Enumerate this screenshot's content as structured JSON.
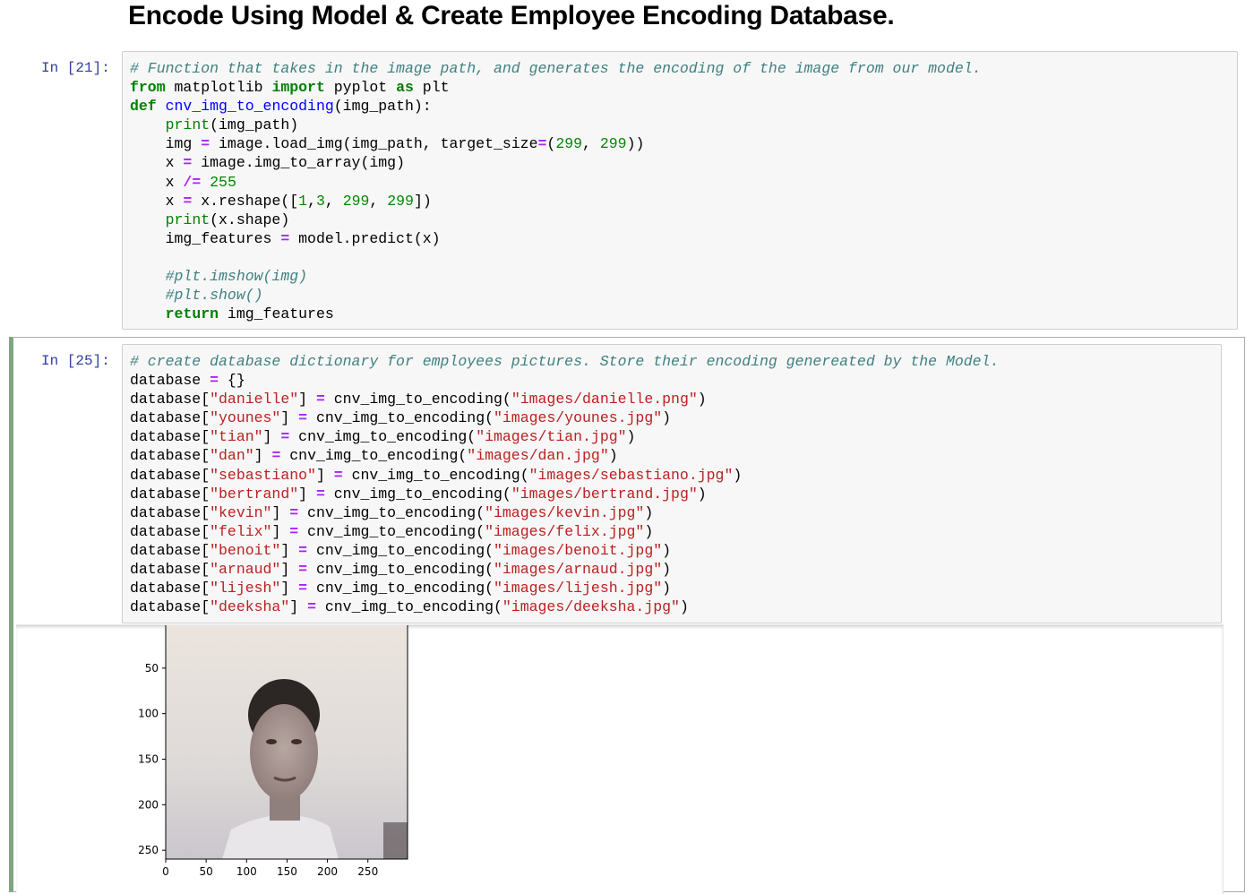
{
  "heading": "Encode Using Model & Create Employee Encoding Database.",
  "cell1": {
    "prompt": "In [21]:",
    "lines": [
      [
        {
          "t": "# Function that takes in the image path, and generates the encoding of the image from our model.",
          "c": "cm-comment"
        }
      ],
      [
        {
          "t": "from",
          "c": "cm-keyword"
        },
        {
          "t": " matplotlib "
        },
        {
          "t": "import",
          "c": "cm-keyword"
        },
        {
          "t": " pyplot "
        },
        {
          "t": "as",
          "c": "cm-keyword"
        },
        {
          "t": " plt"
        }
      ],
      [
        {
          "t": "def",
          "c": "cm-keyword"
        },
        {
          "t": " "
        },
        {
          "t": "cnv_img_to_encoding",
          "c": "cm-def"
        },
        {
          "t": "(img_path):"
        }
      ],
      [
        {
          "t": "    "
        },
        {
          "t": "print",
          "c": "cm-builtin"
        },
        {
          "t": "(img_path)"
        }
      ],
      [
        {
          "t": "    img "
        },
        {
          "t": "=",
          "c": "cm-operator"
        },
        {
          "t": " image.load_img(img_path, target_size"
        },
        {
          "t": "=",
          "c": "cm-operator"
        },
        {
          "t": "("
        },
        {
          "t": "299",
          "c": "cm-number"
        },
        {
          "t": ", "
        },
        {
          "t": "299",
          "c": "cm-number"
        },
        {
          "t": "))"
        }
      ],
      [
        {
          "t": "    x "
        },
        {
          "t": "=",
          "c": "cm-operator"
        },
        {
          "t": " image.img_to_array(img)"
        }
      ],
      [
        {
          "t": "    x "
        },
        {
          "t": "/=",
          "c": "cm-operator"
        },
        {
          "t": " "
        },
        {
          "t": "255",
          "c": "cm-number"
        }
      ],
      [
        {
          "t": "    x "
        },
        {
          "t": "=",
          "c": "cm-operator"
        },
        {
          "t": " x.reshape(["
        },
        {
          "t": "1",
          "c": "cm-number"
        },
        {
          "t": ","
        },
        {
          "t": "3",
          "c": "cm-number"
        },
        {
          "t": ", "
        },
        {
          "t": "299",
          "c": "cm-number"
        },
        {
          "t": ", "
        },
        {
          "t": "299",
          "c": "cm-number"
        },
        {
          "t": "])"
        }
      ],
      [
        {
          "t": "    "
        },
        {
          "t": "print",
          "c": "cm-builtin"
        },
        {
          "t": "(x.shape)"
        }
      ],
      [
        {
          "t": "    img_features "
        },
        {
          "t": "=",
          "c": "cm-operator"
        },
        {
          "t": " model.predict(x)"
        }
      ],
      [
        {
          "t": ""
        }
      ],
      [
        {
          "t": "    "
        },
        {
          "t": "#plt.imshow(img)",
          "c": "cm-comment"
        }
      ],
      [
        {
          "t": "    "
        },
        {
          "t": "#plt.show()",
          "c": "cm-comment"
        }
      ],
      [
        {
          "t": "    "
        },
        {
          "t": "return",
          "c": "cm-keyword"
        },
        {
          "t": " img_features"
        }
      ]
    ]
  },
  "cell2": {
    "prompt": "In [25]:",
    "lines": [
      [
        {
          "t": "# create database dictionary for employees pictures. Store their encoding genereated by the Model.",
          "c": "cm-comment"
        }
      ],
      [
        {
          "t": "database "
        },
        {
          "t": "=",
          "c": "cm-operator"
        },
        {
          "t": " {}"
        }
      ],
      [
        {
          "t": "database["
        },
        {
          "t": "\"danielle\"",
          "c": "cm-string"
        },
        {
          "t": "] "
        },
        {
          "t": "=",
          "c": "cm-operator"
        },
        {
          "t": " cnv_img_to_encoding("
        },
        {
          "t": "\"images/danielle.png\"",
          "c": "cm-string"
        },
        {
          "t": ")"
        }
      ],
      [
        {
          "t": "database["
        },
        {
          "t": "\"younes\"",
          "c": "cm-string"
        },
        {
          "t": "] "
        },
        {
          "t": "=",
          "c": "cm-operator"
        },
        {
          "t": " cnv_img_to_encoding("
        },
        {
          "t": "\"images/younes.jpg\"",
          "c": "cm-string"
        },
        {
          "t": ")"
        }
      ],
      [
        {
          "t": "database["
        },
        {
          "t": "\"tian\"",
          "c": "cm-string"
        },
        {
          "t": "] "
        },
        {
          "t": "=",
          "c": "cm-operator"
        },
        {
          "t": " cnv_img_to_encoding("
        },
        {
          "t": "\"images/tian.jpg\"",
          "c": "cm-string"
        },
        {
          "t": ")"
        }
      ],
      [
        {
          "t": "database["
        },
        {
          "t": "\"dan\"",
          "c": "cm-string"
        },
        {
          "t": "] "
        },
        {
          "t": "=",
          "c": "cm-operator"
        },
        {
          "t": " cnv_img_to_encoding("
        },
        {
          "t": "\"images/dan.jpg\"",
          "c": "cm-string"
        },
        {
          "t": ")"
        }
      ],
      [
        {
          "t": "database["
        },
        {
          "t": "\"sebastiano\"",
          "c": "cm-string"
        },
        {
          "t": "] "
        },
        {
          "t": "=",
          "c": "cm-operator"
        },
        {
          "t": " cnv_img_to_encoding("
        },
        {
          "t": "\"images/sebastiano.jpg\"",
          "c": "cm-string"
        },
        {
          "t": ")"
        }
      ],
      [
        {
          "t": "database["
        },
        {
          "t": "\"bertrand\"",
          "c": "cm-string"
        },
        {
          "t": "] "
        },
        {
          "t": "=",
          "c": "cm-operator"
        },
        {
          "t": " cnv_img_to_encoding("
        },
        {
          "t": "\"images/bertrand.jpg\"",
          "c": "cm-string"
        },
        {
          "t": ")"
        }
      ],
      [
        {
          "t": "database["
        },
        {
          "t": "\"kevin\"",
          "c": "cm-string"
        },
        {
          "t": "] "
        },
        {
          "t": "=",
          "c": "cm-operator"
        },
        {
          "t": " cnv_img_to_encoding("
        },
        {
          "t": "\"images/kevin.jpg\"",
          "c": "cm-string"
        },
        {
          "t": ")"
        }
      ],
      [
        {
          "t": "database["
        },
        {
          "t": "\"felix\"",
          "c": "cm-string"
        },
        {
          "t": "] "
        },
        {
          "t": "=",
          "c": "cm-operator"
        },
        {
          "t": " cnv_img_to_encoding("
        },
        {
          "t": "\"images/felix.jpg\"",
          "c": "cm-string"
        },
        {
          "t": ")"
        }
      ],
      [
        {
          "t": "database["
        },
        {
          "t": "\"benoit\"",
          "c": "cm-string"
        },
        {
          "t": "] "
        },
        {
          "t": "=",
          "c": "cm-operator"
        },
        {
          "t": " cnv_img_to_encoding("
        },
        {
          "t": "\"images/benoit.jpg\"",
          "c": "cm-string"
        },
        {
          "t": ")"
        }
      ],
      [
        {
          "t": "database["
        },
        {
          "t": "\"arnaud\"",
          "c": "cm-string"
        },
        {
          "t": "] "
        },
        {
          "t": "=",
          "c": "cm-operator"
        },
        {
          "t": " cnv_img_to_encoding("
        },
        {
          "t": "\"images/arnaud.jpg\"",
          "c": "cm-string"
        },
        {
          "t": ")"
        }
      ],
      [
        {
          "t": "database["
        },
        {
          "t": "\"lijesh\"",
          "c": "cm-string"
        },
        {
          "t": "] "
        },
        {
          "t": "=",
          "c": "cm-operator"
        },
        {
          "t": " cnv_img_to_encoding("
        },
        {
          "t": "\"images/lijesh.jpg\"",
          "c": "cm-string"
        },
        {
          "t": ")"
        }
      ],
      [
        {
          "t": "database["
        },
        {
          "t": "\"deeksha\"",
          "c": "cm-string"
        },
        {
          "t": "] "
        },
        {
          "t": "=",
          "c": "cm-operator"
        },
        {
          "t": " cnv_img_to_encoding("
        },
        {
          "t": "\"images/deeksha.jpg\"",
          "c": "cm-string"
        },
        {
          "t": ")"
        }
      ]
    ]
  },
  "output_plot": {
    "y_ticks": [
      "50",
      "100",
      "150",
      "200",
      "250"
    ],
    "x_ticks": [
      "0",
      "50",
      "100",
      "150",
      "200",
      "250"
    ],
    "image_content": "face-photo"
  }
}
